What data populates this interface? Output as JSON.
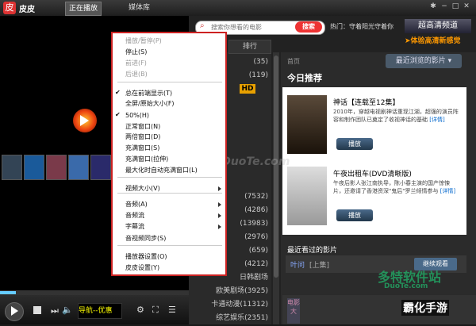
{
  "app": {
    "name": "皮皮",
    "logo_glyph": "皮"
  },
  "top_tabs": [
    {
      "label": "正在播放"
    },
    {
      "label": "媒体库"
    }
  ],
  "window_buttons": [
    "✱",
    "−",
    "□",
    "✕"
  ],
  "player": {
    "marquee": "导航--优惠",
    "icons": [
      "play-icon",
      "stop-icon",
      "next-icon",
      "volume-icon",
      "settings-icon",
      "fullscreen-icon",
      "playlist-icon"
    ]
  },
  "search": {
    "placeholder": "搜索你想看的电影",
    "button": "搜索",
    "hot": "热门：守着阳光守着你"
  },
  "banner": {
    "title": "超高清频道",
    "subtitle": "➤体验高清新感觉"
  },
  "category": {
    "tab": "排行",
    "rows": [
      {
        "label": "(35)"
      },
      {
        "label": "(119)"
      },
      {
        "label": "HD"
      },
      {
        "label": ""
      },
      {
        "label": ""
      },
      {
        "label": ""
      },
      {
        "label": ""
      },
      {
        "label": ""
      },
      {
        "label": ""
      },
      {
        "label": ""
      },
      {
        "label": "(7532)"
      },
      {
        "label": "(4286)"
      },
      {
        "label": "(13983)"
      },
      {
        "label": "(2976)"
      },
      {
        "label": "(659)"
      },
      {
        "label": "(4212)"
      },
      {
        "label": "日韩剧场"
      },
      {
        "label": "欧美剧场(3925)"
      },
      {
        "label": "卡通动漫(11312)"
      },
      {
        "label": "综艺娱乐(2351)"
      }
    ]
  },
  "main": {
    "home": "首页",
    "recent_dropdown": "最近浏览的影片",
    "today_title": "今日推荐",
    "movies": [
      {
        "title": "神话【连载至12集】",
        "desc": "2010年，穿越电视剧神话重现江湖，超强的演员阵容和制作团队已奠定了收视神话的基础",
        "more": "[详情]",
        "play": "播放"
      },
      {
        "title": "午夜出租车(DVD清晰版)",
        "desc": "午夜后影人张江南执导，陈小春主演的国产惊悚片，还邀请了香港资深\"鬼后\"罗兰倾情参与",
        "more": "[详情]",
        "play": "播放"
      }
    ],
    "recent_title": "最近看过的影片",
    "recent_item": "叶问",
    "recent_ep": "[上集]",
    "continue": "继续观看",
    "bottom_tab": "电影大"
  },
  "watermarks": {
    "center": "www.DuoTe.com",
    "duote": "多特软件站",
    "site": "DuoTe.com",
    "brand": "霸化手游"
  },
  "menu": {
    "items": [
      {
        "label": "播放/暂停(P)",
        "disabled": true
      },
      {
        "label": "停止(S)",
        "disabled": false
      },
      {
        "label": "前进(F)",
        "disabled": true
      },
      {
        "label": "后退(B)",
        "disabled": true
      },
      {
        "label": "总在前端显示(T)",
        "checked": true
      },
      {
        "label": "全屏/原始大小(F)"
      },
      {
        "label": "50%(H)",
        "checked": true
      },
      {
        "label": "正常窗口(N)"
      },
      {
        "label": "两倍窗口(D)"
      },
      {
        "label": "充满窗口(S)"
      },
      {
        "label": "充满窗口(拉伸)"
      },
      {
        "label": "最大化时自动充满窗口(L)"
      },
      {
        "label": "视频大小(V)",
        "submenu": true
      },
      {
        "label": "音频(A)",
        "submenu": true
      },
      {
        "label": "音频流",
        "submenu": true
      },
      {
        "label": "字幕流",
        "submenu": true
      },
      {
        "label": "音视频同步(S)"
      },
      {
        "label": "播放器设置(O)"
      },
      {
        "label": "皮皮设置(Y)"
      }
    ]
  }
}
